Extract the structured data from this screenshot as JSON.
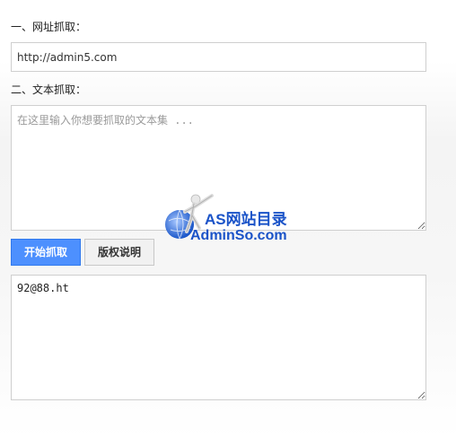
{
  "url_section": {
    "label": "一、网址抓取：",
    "value": "http://admin5.com"
  },
  "text_section": {
    "label": "二、文本抓取：",
    "placeholder": "在这里输入你想要抓取的文本集 ..."
  },
  "buttons": {
    "start": "开始抓取",
    "copyright": "版权说明"
  },
  "result": {
    "value": "92@88.ht"
  },
  "watermark": {
    "line1": "AS网站目录",
    "line2": "AdminSo.com",
    "icon": "globe-figure-icon"
  },
  "colors": {
    "primary_button": "#4d90fe",
    "watermark": "#1a53c8"
  }
}
